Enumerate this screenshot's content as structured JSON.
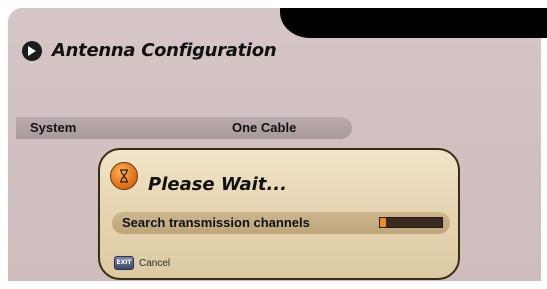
{
  "screen": {
    "title": "Antenna Configuration",
    "title_icon": "arrow-right-circle-icon"
  },
  "settings": {
    "system_label": "System",
    "system_value": "One Cable"
  },
  "dialog": {
    "icon": "hourglass-icon",
    "title": "Please Wait...",
    "status_label": "Search transmission channels",
    "progress_percent": 10,
    "cancel_key": "EXIT",
    "cancel_label": "Cancel"
  },
  "colors": {
    "panel": "#d7c6c7",
    "dialog": "#e7d6b3",
    "progress_fill": "#f08a1a",
    "progress_track": "#3a2a22"
  }
}
